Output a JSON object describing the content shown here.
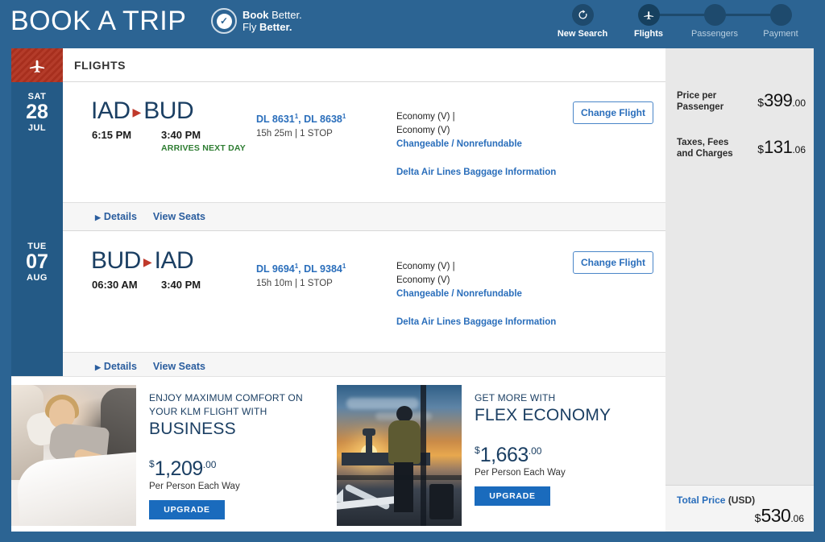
{
  "header": {
    "brand": "BOOK A TRIP",
    "badge_line1_bold": "Book",
    "badge_line1_light": "Better.",
    "badge_line2_light": "Fly",
    "badge_line2_bold": "Better.",
    "badge_check": "✓"
  },
  "steps": [
    {
      "label": "New Search",
      "icon": "refresh-icon",
      "state": "action"
    },
    {
      "label": "Flights",
      "icon": "airplane-icon",
      "state": "active"
    },
    {
      "label": "Passengers",
      "icon": "dot-icon",
      "state": "inactive"
    },
    {
      "label": "Payment",
      "icon": "dot-icon",
      "state": "inactive"
    }
  ],
  "section": {
    "title": "FLIGHTS",
    "icon": "airplane-icon"
  },
  "flights": [
    {
      "date": {
        "dow": "SAT",
        "day": "28",
        "month": "JUL"
      },
      "origin": "IAD",
      "destination": "BUD",
      "depart_time": "6:15 PM",
      "arrive_time": "3:40 PM",
      "arrives_next_day": "ARRIVES NEXT DAY",
      "flight_numbers": "DL 8631",
      "flight_numbers_2": "DL 8638",
      "footnote": "1",
      "duration_stops": "15h 25m | 1 STOP",
      "cabin_line1": "Economy (V) |",
      "cabin_line2": "Economy (V)",
      "fare_rules": "Changeable / Nonrefundable",
      "baggage_link": "Delta Air Lines Baggage Information",
      "change_button": "Change Flight",
      "details_label": "Details",
      "seats_label": "View Seats"
    },
    {
      "date": {
        "dow": "TUE",
        "day": "07",
        "month": "AUG"
      },
      "origin": "BUD",
      "destination": "IAD",
      "depart_time": "06:30 AM",
      "arrive_time": "3:40 PM",
      "arrives_next_day": "",
      "flight_numbers": "DL 9694",
      "flight_numbers_2": "DL 9384",
      "footnote": "1",
      "duration_stops": "15h 10m | 1 STOP",
      "cabin_line1": "Economy (V) |",
      "cabin_line2": "Economy (V)",
      "fare_rules": "Changeable / Nonrefundable",
      "baggage_link": "Delta Air Lines Baggage Information",
      "change_button": "Change Flight",
      "details_label": "Details",
      "seats_label": "View Seats"
    }
  ],
  "promos": [
    {
      "image": "business-class-lie-flat-seat-photo",
      "kicker": "ENJOY MAXIMUM COMFORT ON YOUR KLM FLIGHT WITH",
      "title": "BUSINESS",
      "currency": "$",
      "amount": "1,209",
      "cents": ".00",
      "subtitle": "Per Person Each Way",
      "button": "UPGRADE"
    },
    {
      "image": "traveler-at-airport-window-sunset-photo",
      "kicker": "GET MORE WITH",
      "title": "FLEX ECONOMY",
      "currency": "$",
      "amount": "1,663",
      "cents": ".00",
      "subtitle": "Per Person Each Way",
      "button": "UPGRADE"
    }
  ],
  "pricing": {
    "rows": [
      {
        "label_line1": "Price per",
        "label_line2": "Passenger",
        "currency": "$",
        "amount": "399",
        "cents": ".00"
      },
      {
        "label_line1": "Taxes, Fees",
        "label_line2": "and Charges",
        "currency": "$",
        "amount": "131",
        "cents": ".06"
      }
    ],
    "total_label": "Total Price",
    "total_currency_label": "(USD)",
    "total_currency": "$",
    "total_amount": "530",
    "total_cents": ".06"
  },
  "colors": {
    "brand_blue": "#2c6493",
    "rail_blue": "#245a86",
    "accent_red": "#b0311f",
    "link_blue": "#2a6ebb",
    "green": "#2e7d32",
    "button_blue": "#1a6bbd"
  }
}
